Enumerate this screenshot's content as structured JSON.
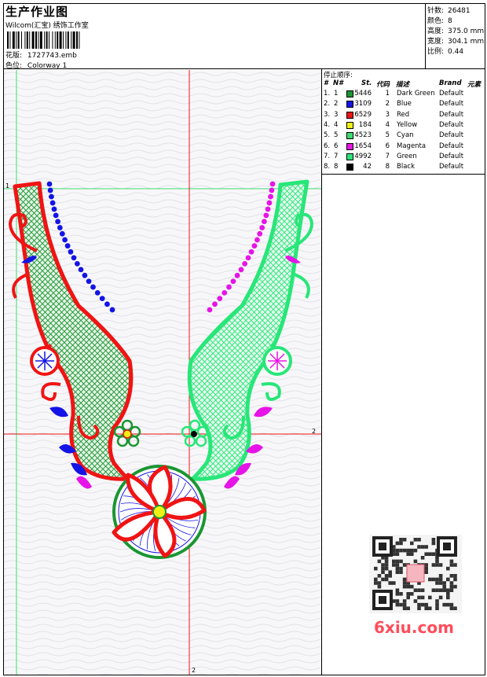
{
  "header": {
    "title": "生产作业图",
    "company": "Wilcom(汇宝) 绣饰工作室",
    "pattern_label": "花版:",
    "pattern_value": "1727743.emb",
    "colorway_label": "色位:",
    "colorway_value": "Colorway 1"
  },
  "stats": [
    {
      "label": "针数:",
      "value": "26481"
    },
    {
      "label": "颜色:",
      "value": "8"
    },
    {
      "label": "高度:",
      "value": "375.0 mm"
    },
    {
      "label": "宽度:",
      "value": "304.1 mm"
    },
    {
      "label": "比例:",
      "value": "0.44"
    }
  ],
  "stop_table": {
    "title": "停止顺序:",
    "headers": [
      "#",
      "N#",
      "St.",
      "代码",
      "描述",
      "Brand",
      "元素"
    ],
    "rows": [
      {
        "num": "1.",
        "n": "1",
        "color": "#1a9632",
        "st": "5446",
        "code": "1",
        "desc": "Dark Green",
        "brand": "Default"
      },
      {
        "num": "2.",
        "n": "2",
        "color": "#1414e6",
        "st": "3109",
        "code": "2",
        "desc": "Blue",
        "brand": "Default"
      },
      {
        "num": "3.",
        "n": "3",
        "color": "#f01414",
        "st": "6529",
        "code": "3",
        "desc": "Red",
        "brand": "Default"
      },
      {
        "num": "4.",
        "n": "4",
        "color": "#f0f014",
        "st": "184",
        "code": "4",
        "desc": "Yellow",
        "brand": "Default"
      },
      {
        "num": "5.",
        "n": "5",
        "color": "#3cdc6e",
        "st": "4523",
        "code": "5",
        "desc": "Cyan",
        "brand": "Default"
      },
      {
        "num": "6.",
        "n": "6",
        "color": "#e614e6",
        "st": "1654",
        "code": "6",
        "desc": "Magenta",
        "brand": "Default"
      },
      {
        "num": "7.",
        "n": "7",
        "color": "#28e678",
        "st": "4992",
        "code": "7",
        "desc": "Green",
        "brand": "Default"
      },
      {
        "num": "8.",
        "n": "8",
        "color": "#000000",
        "st": "42",
        "code": "8",
        "desc": "Black",
        "brand": "Default"
      }
    ]
  },
  "guides": {
    "v1": "1",
    "h1": "1",
    "h2": "2",
    "v2": "2"
  },
  "watermark": "6xiu.com",
  "colors": {
    "red": "#f01414",
    "green": "#1a9632",
    "cyan": "#28e678",
    "blue": "#1414e6",
    "magenta": "#e614e6",
    "yellow": "#f0f014"
  }
}
